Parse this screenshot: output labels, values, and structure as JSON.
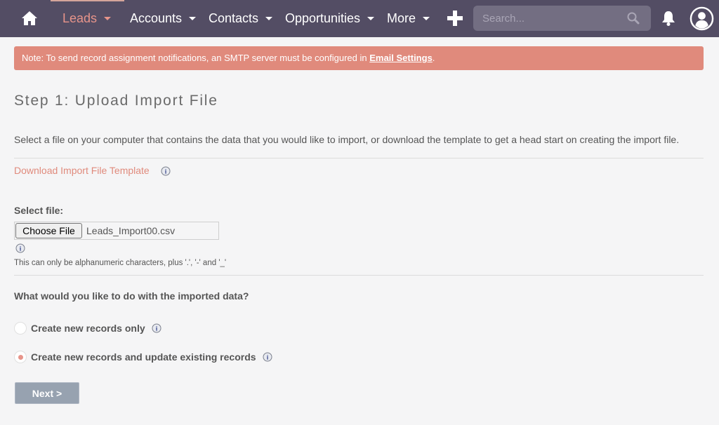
{
  "nav": {
    "items": [
      {
        "label": "Leads",
        "active": true
      },
      {
        "label": "Accounts",
        "active": false
      },
      {
        "label": "Contacts",
        "active": false
      },
      {
        "label": "Opportunities",
        "active": false
      },
      {
        "label": "More",
        "active": false
      }
    ],
    "search_placeholder": "Search...",
    "search_value": "",
    "icons": [
      "home-icon",
      "plus-icon",
      "search-icon",
      "bell-icon",
      "user-avatar-icon"
    ]
  },
  "alert": {
    "text": "Note: To send record assignment notifications, an SMTP server must be configured in ",
    "link_label": "Email Settings",
    "suffix": "."
  },
  "page": {
    "title": "Step 1: Upload Import File",
    "description": "Select a file on your computer that contains the data that you would like to import, or download the template to get a head start on creating the import file.",
    "download_link": "Download Import File Template",
    "select_file_label": "Select file:",
    "choose_file_button": "Choose File",
    "file_name": "Leads_Import00.csv",
    "file_hint": "This can only be alphanumeric characters, plus '.', '-' and '_'",
    "question": "What would you like to do with the imported data?",
    "options": [
      {
        "label": "Create new records only",
        "checked": false
      },
      {
        "label": "Create new records and update existing records",
        "checked": true
      }
    ],
    "next_button": "Next >"
  },
  "colors": {
    "nav_bg": "#534d64",
    "accent": "#e7948a",
    "alert_bg": "#e08a7c",
    "next_button_bg": "#97a2b0"
  }
}
